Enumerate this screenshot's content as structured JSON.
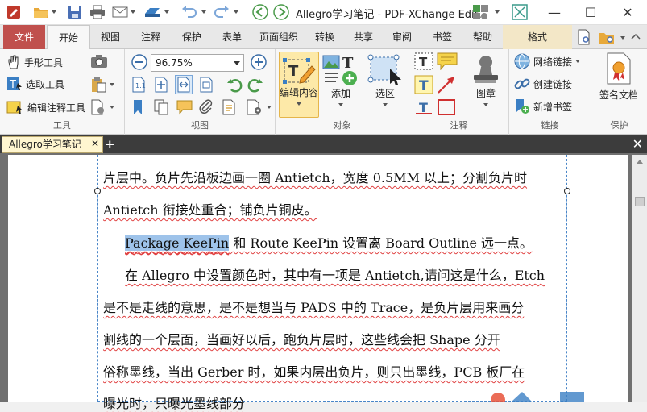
{
  "titlebar": {
    "title": "Allegro学习笔记 - PDF-XChange Edit...",
    "colors": {
      "app_icon": "#c0392b",
      "folder": "#e8a93a",
      "nav": "#4a9a4a"
    }
  },
  "menu": {
    "tabs": [
      "文件",
      "开始",
      "视图",
      "注释",
      "保护",
      "表单",
      "页面组织",
      "转换",
      "共享",
      "审阅",
      "书签",
      "帮助",
      "格式"
    ],
    "active": "开始"
  },
  "ribbon": {
    "tools": {
      "label": "工具",
      "hand": "手形工具",
      "select": "选取工具",
      "edit_annot": "编辑注释工具"
    },
    "view": {
      "label": "视图",
      "zoom": "96.75%"
    },
    "objects": {
      "label": "对象",
      "edit_content": "编辑内容",
      "add": "添加",
      "select_area": "选区"
    },
    "comments": {
      "label": "注释",
      "stamp": "图章"
    },
    "links": {
      "label": "链接",
      "web_links": "网络链接",
      "create_link": "创建链接",
      "new_bookmark": "新增书签"
    },
    "protect": {
      "label": "保护",
      "sign": "签名文档"
    }
  },
  "document": {
    "tab_name": "Allegro学习笔记",
    "lines": [
      "片层中。负片先沿板边画一圈 Antietch，宽度 0.5MM 以上；分割负片时",
      "Antietch 衔接处重合；铺负片铜皮。",
      "Package KeePin",
      " 和 Route KeePin 设置离 Board Outline 远一点。",
      "在 Allegro 中设置颜色时，其中有一项是 Antietch,请问这是什么，Etch",
      "是不是走线的意思，是不是想当与 PADS 中的 Trace，是负片层用来画分",
      "割线的一个层面，当画好以后，跑负片层时，这些线会把 Shape 分开",
      "俗称墨线，当出 Gerber 时，如果内层出负片，则只出墨线，PCB 板厂在",
      "曝光时，只曝光墨线部分"
    ]
  }
}
